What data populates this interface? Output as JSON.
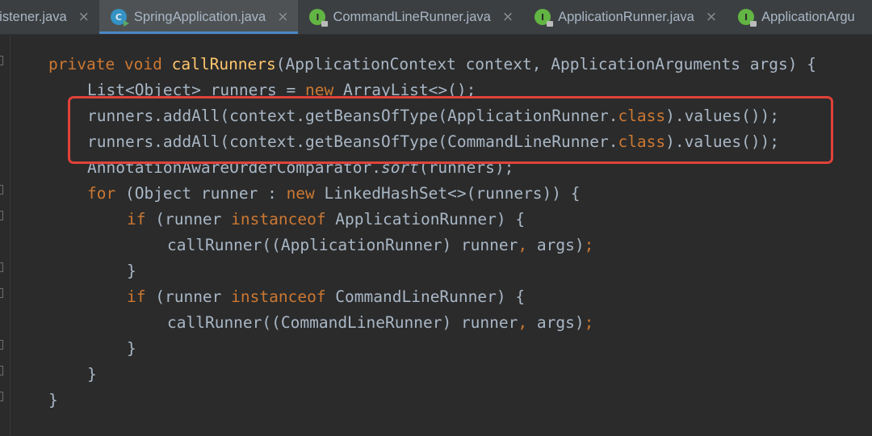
{
  "tabs": [
    {
      "label": "Listener.java",
      "icon": "interface-icon",
      "active": false
    },
    {
      "label": "SpringApplication.java",
      "icon": "class-icon",
      "active": true
    },
    {
      "label": "CommandLineRunner.java",
      "icon": "interface-icon",
      "active": false
    },
    {
      "label": "ApplicationRunner.java",
      "icon": "interface-icon",
      "active": false
    },
    {
      "label": "ApplicationArgu",
      "icon": "interface-icon",
      "active": false
    }
  ],
  "icons": {
    "close": "×",
    "class_letter": "C",
    "interface_letter": "I"
  },
  "code": {
    "l1": {
      "p1": "private void ",
      "fn": "callRunners",
      "p2": "(ApplicationContext context, ApplicationArguments args) {"
    },
    "l2": {
      "p1": "List<Object> runners = ",
      "kw": "new ",
      "p2": "ArrayList<>();"
    },
    "l3": {
      "p1": "runners.addAll(context.getBeansOfType(ApplicationRunner.",
      "kw": "class",
      "p2": ").values());"
    },
    "l4": {
      "p1": "runners.addAll(context.getBeansOfType(CommandLineRunner.",
      "kw": "class",
      "p2": ").values());"
    },
    "l5": {
      "p1": "AnnotationAwareOrderComparator.",
      "it": "sort",
      "p2": "(runners);"
    },
    "l6": {
      "kw1": "for ",
      "p1": "(Object runner : ",
      "kw2": "new ",
      "p2": "LinkedHashSet<>(runners)) {"
    },
    "l7": {
      "kw1": "if ",
      "p1": "(runner ",
      "kw2": "instanceof ",
      "p2": "ApplicationRunner) {"
    },
    "l8": {
      "p1": "callRunner((ApplicationRunner) runner",
      "comma": ",",
      "p2": " args)",
      "semi": ";"
    },
    "l9": "}",
    "l10": {
      "kw1": "if ",
      "p1": "(runner ",
      "kw2": "instanceof ",
      "p2": "CommandLineRunner) {"
    },
    "l11": {
      "p1": "callRunner((CommandLineRunner) runner",
      "comma": ",",
      "p2": " args)",
      "semi": ";"
    },
    "l12": "}",
    "l13": "}",
    "l14": "}"
  },
  "colors": {
    "keyword": "#cc7832",
    "method": "#ffc66d",
    "text": "#a9b7c6",
    "background": "#2b2b2b",
    "highlight_box": "#e0423a"
  }
}
